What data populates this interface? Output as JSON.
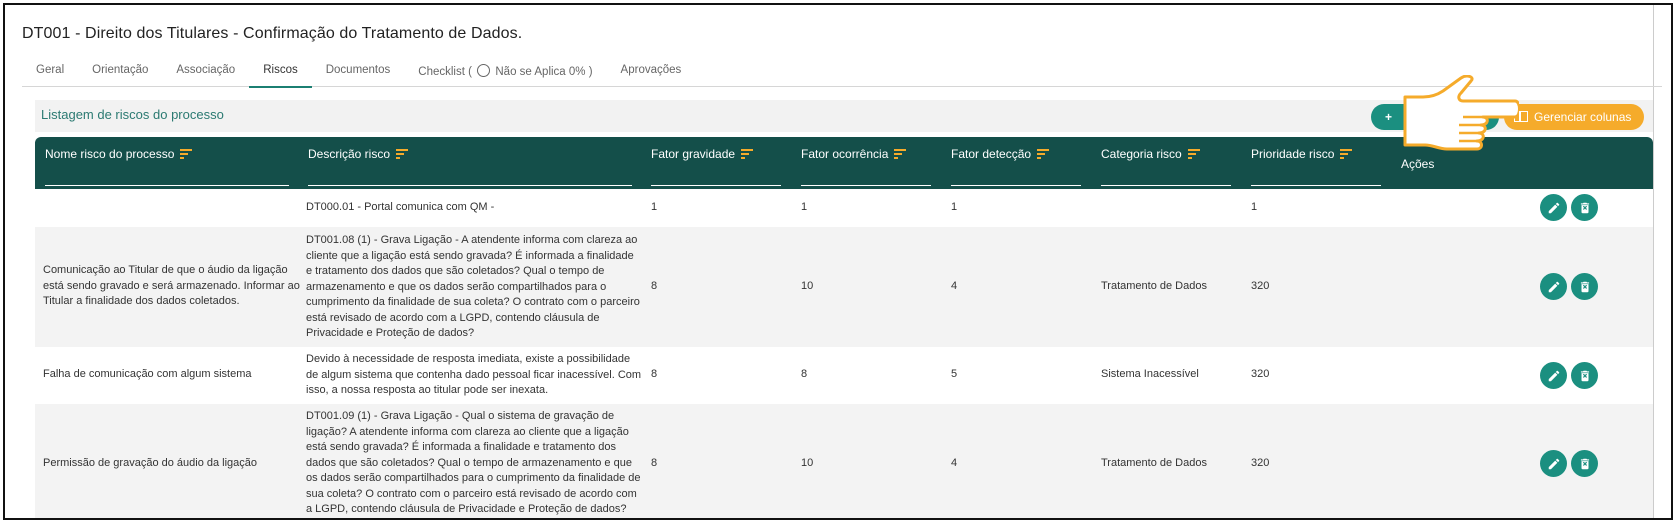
{
  "page": {
    "title": "DT001 - Direito dos Titulares - Confirmação do Tratamento de Dados."
  },
  "tabs": [
    {
      "label": "Geral"
    },
    {
      "label": "Orientação"
    },
    {
      "label": "Associação"
    },
    {
      "label": "Riscos",
      "active": true
    },
    {
      "label": "Documentos"
    },
    {
      "label": "Checklist ("
    },
    {
      "label": "Aprovações"
    }
  ],
  "checklist_suffix": "Não se Aplica 0% )",
  "list": {
    "title": "Listagem de riscos do processo",
    "add_label": "+",
    "manage_columns_label": "Gerenciar colunas"
  },
  "table": {
    "headers": {
      "name": "Nome risco do processo",
      "description": "Descrição risco",
      "severity": "Fator gravidade",
      "occurrence": "Fator ocorrência",
      "detection": "Fator detecção",
      "category": "Categoria risco",
      "priority": "Prioridade risco",
      "actions": "Ações"
    },
    "rows": [
      {
        "name": "",
        "description": "DT000.01 - Portal comunica com QM -",
        "severity": "1",
        "occurrence": "1",
        "detection": "1",
        "category": "",
        "priority": "1"
      },
      {
        "name": "Comunicação ao Titular de que o áudio da ligação está sendo gravado e será armazenado. Informar ao Titular a finalidade dos dados coletados.",
        "description": "DT001.08 (1) - Grava Ligação - A atendente informa com clareza ao cliente que a ligação está sendo gravada? É informada a finalidade e tratamento dos dados que são coletados? Qual o tempo de armazenamento e que os dados serão compartilhados para o cumprimento da finalidade de sua coleta? O contrato com o parceiro está revisado de acordo com a LGPD, contendo cláusula de Privacidade e Proteção de dados?",
        "severity": "8",
        "occurrence": "10",
        "detection": "4",
        "category": "Tratamento de Dados",
        "priority": "320"
      },
      {
        "name": "Falha de comunicação com algum sistema",
        "description": "Devido à necessidade de resposta imediata, existe a possibilidade de algum sistema que contenha dado pessoal ficar inacessível. Com isso, a nossa resposta ao titular pode ser inexata.",
        "severity": "8",
        "occurrence": "8",
        "detection": "5",
        "category": "Sistema Inacessível",
        "priority": "320"
      },
      {
        "name": "Permissão de gravação do áudio da ligação",
        "description": "DT001.09 (1) - Grava Ligação - Qual o sistema de gravação de ligação? A atendente informa com clareza ao cliente que a ligação está sendo gravada? É informada a finalidade e tratamento dos dados que são coletados? Qual o tempo de armazenamento e que os dados serão compartilhados para o cumprimento da finalidade de sua coleta? O contrato com o parceiro está revisado de acordo com a LGPD, contendo cláusula de Privacidade e Proteção de dados?",
        "severity": "8",
        "occurrence": "10",
        "detection": "4",
        "category": "Tratamento de Dados",
        "priority": "320"
      }
    ]
  },
  "colors": {
    "header_bg": "#144f4a",
    "accent_teal": "#1b8f80",
    "accent_orange": "#f5ab2b",
    "title_teal": "#2b7a72"
  },
  "icons": [
    "sort-icon",
    "edit-icon",
    "delete-icon",
    "columns-icon",
    "pointing-hand-icon",
    "radio-icon"
  ]
}
